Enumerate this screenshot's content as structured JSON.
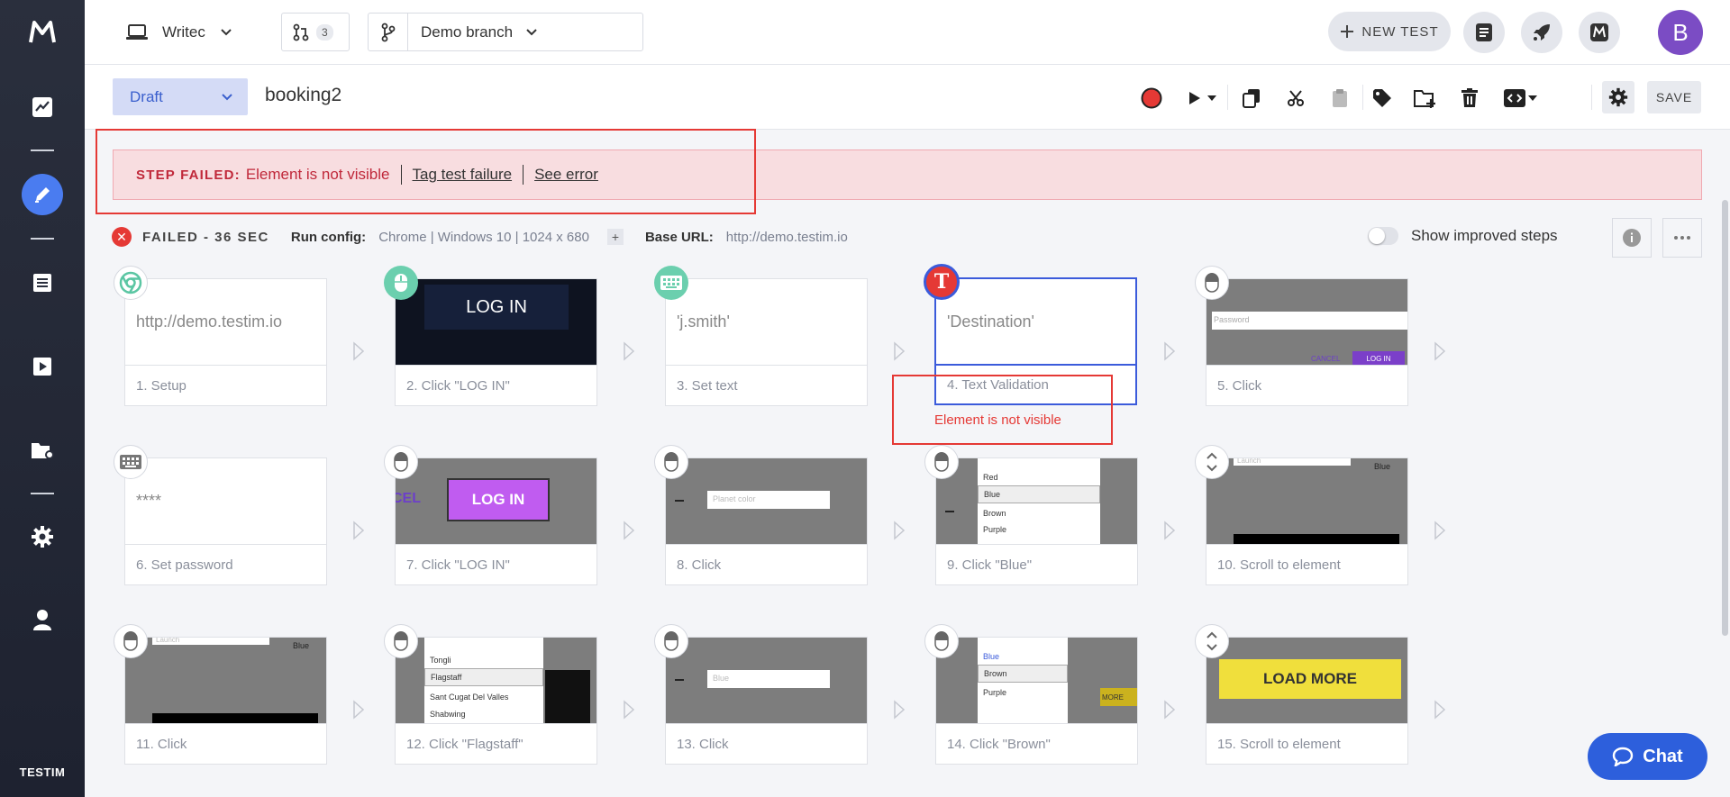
{
  "sidebar": {
    "brand": "TESTIM"
  },
  "topbar": {
    "project_name": "Writec",
    "pr_count": "3",
    "branch": "Demo branch",
    "new_test": "NEW TEST",
    "avatar_letter": "B"
  },
  "testbar": {
    "status": "Draft",
    "test_name": "booking2",
    "save_label": "SAVE"
  },
  "banner": {
    "label": "STEP FAILED:",
    "message": "Element is not visible",
    "tag_link": "Tag test failure",
    "error_link": "See error"
  },
  "status_row": {
    "result": "FAILED - 36 SEC",
    "run_config_label": "Run config:",
    "run_config_value": "Chrome | Windows 10 | 1024 x 680",
    "base_url_label": "Base URL:",
    "base_url_value": "http://demo.testim.io",
    "improved_steps_label": "Show improved steps"
  },
  "steps": [
    {
      "caption": "1. Setup",
      "text": "http://demo.testim.io",
      "icon": "chrome-icon"
    },
    {
      "caption": "2. Click \"LOG IN\"",
      "thumb_text": "LOG IN",
      "icon": "mouse-icon"
    },
    {
      "caption": "3. Set text",
      "text": "'j.smith'",
      "icon": "keyboard-icon"
    },
    {
      "caption": "4. Text Validation",
      "text": "'Destination'",
      "icon": "text-validation-icon",
      "error": "Element is not visible"
    },
    {
      "caption": "5. Click",
      "thumb_text": "Password",
      "thumb_text2": "CANCEL",
      "thumb_text3": "LOG IN",
      "icon": "mouse-icon"
    },
    {
      "caption": "6. Set password",
      "text": "****",
      "icon": "keyboard-icon"
    },
    {
      "caption": "7. Click \"LOG IN\"",
      "thumb_text": "LOG IN",
      "thumb_text2": "CEL",
      "icon": "mouse-icon"
    },
    {
      "caption": "8. Click",
      "thumb_text": "Planet color",
      "icon": "mouse-icon"
    },
    {
      "caption": "9. Click \"Blue\"",
      "options": [
        "Red",
        "Blue",
        "Brown",
        "Purple"
      ],
      "icon": "mouse-icon"
    },
    {
      "caption": "10. Scroll to element",
      "thumb_text": "Launch",
      "thumb_text2": "Blue",
      "icon": "scroll-icon"
    },
    {
      "caption": "11. Click",
      "thumb_text": "Launch",
      "thumb_text2": "Blue",
      "icon": "mouse-icon"
    },
    {
      "caption": "12. Click \"Flagstaff\"",
      "options": [
        "Tongli",
        "Flagstaff",
        "Sant Cugat Del Valles",
        "Shabwing"
      ],
      "icon": "mouse-icon"
    },
    {
      "caption": "13. Click",
      "thumb_text": "Blue",
      "icon": "mouse-icon"
    },
    {
      "caption": "14. Click \"Brown\"",
      "options": [
        "Blue",
        "Brown",
        "Purple"
      ],
      "thumb_text": "MORE",
      "icon": "mouse-icon"
    },
    {
      "caption": "15. Scroll to element",
      "thumb_text": "LOAD MORE",
      "icon": "scroll-icon"
    }
  ],
  "chat": {
    "label": "Chat"
  },
  "colors": {
    "accent": "#4a7cf0",
    "error": "#e53935",
    "banner_bg": "#f8dde0",
    "avatar": "#7b4cc4",
    "chat": "#2d5fdc"
  }
}
